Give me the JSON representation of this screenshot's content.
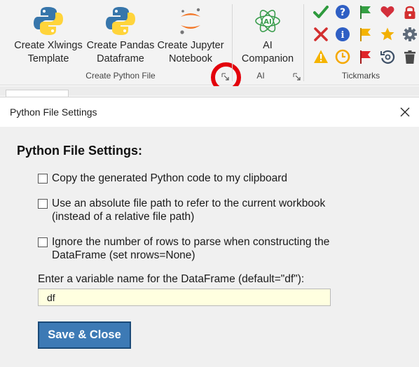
{
  "ribbon": {
    "buttons": {
      "xlwings": "Create Xlwings\nTemplate",
      "pandas": "Create Pandas\nDataframe",
      "jupyter": "Create Jupyter\nNotebook",
      "ai": "AI\nCompanion"
    },
    "groups": {
      "create_python_file": "Create Python File",
      "ai": "AI",
      "tickmarks": "Tickmarks"
    },
    "ai_icon_text": "AI",
    "colors": {
      "python_blue": "#3776ab",
      "python_yellow": "#ffd43b",
      "jupyter_orange": "#f37626",
      "ai_green": "#3a9d4d",
      "highlight_ring": "#e3000b"
    },
    "tickmark_icons": [
      [
        "check-icon",
        "question-icon",
        "green-flag-icon",
        "heart-icon",
        "lock-icon"
      ],
      [
        "x-icon",
        "info-icon",
        "yellow-flag-icon",
        "star-icon",
        "gear-icon"
      ],
      [
        "warning-icon",
        "clock-icon",
        "red-flag-icon",
        "history-icon",
        "trash-icon"
      ]
    ]
  },
  "dialog": {
    "window_title": "Python File Settings",
    "heading": "Python File Settings:",
    "options": [
      {
        "label": "Copy the generated Python code to my clipboard",
        "checked": false
      },
      {
        "label": "Use an absolute file path to refer to the current workbook\n(instead of a relative file path)",
        "checked": false
      },
      {
        "label": "Ignore the number of rows to parse when constructing the\nDataFrame (set nrows=None)",
        "checked": false
      }
    ],
    "variable_prompt": "Enter a variable name for the DataFrame (default=\"df\"):",
    "variable_value": "df",
    "save_button": "Save & Close"
  }
}
